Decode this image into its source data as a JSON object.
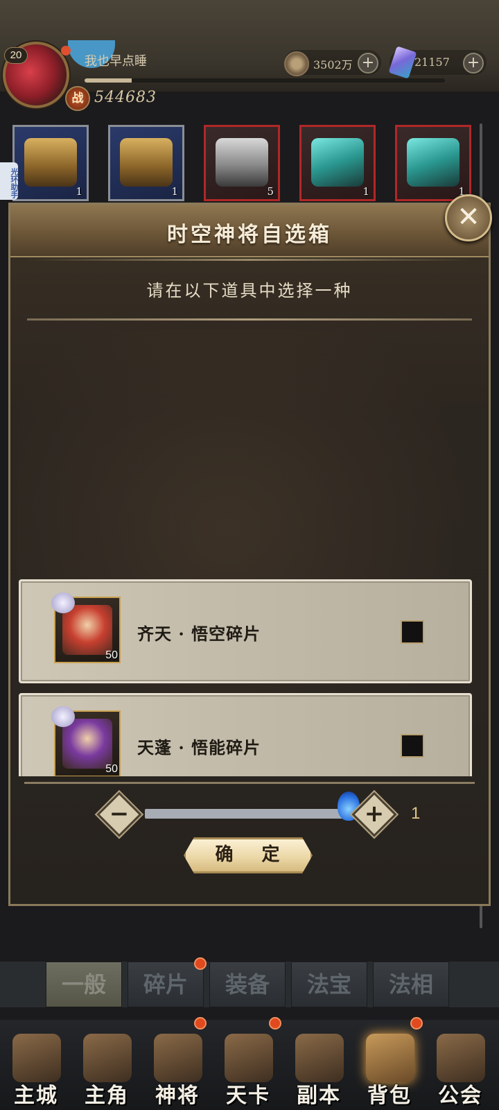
{
  "player": {
    "level": "20",
    "name": "我也早点睡",
    "power_icon": "战",
    "power": "544683",
    "exp_progress": 0.13
  },
  "currencies": [
    {
      "icon": "coin-icon",
      "value": "3502万"
    },
    {
      "icon": "crystal-icon",
      "value": "21157"
    }
  ],
  "items": [
    {
      "art": "gold-chest",
      "count": "1"
    },
    {
      "art": "gold-chest",
      "count": "1"
    },
    {
      "art": "silver-box",
      "count": "5"
    },
    {
      "art": "cyan-cube",
      "count": "1"
    },
    {
      "art": "cyan-cube",
      "count": "1"
    }
  ],
  "side_tab": "光环助手",
  "modal": {
    "title": "时空神将自选箱",
    "prompt": "请在以下道具中选择一种",
    "options": [
      {
        "name": "齐天 · 悟空碎片",
        "count": "50",
        "checked": false
      },
      {
        "name": "天蓬 · 悟能碎片",
        "count": "50",
        "checked": false
      }
    ],
    "minus": "−",
    "plus": "+",
    "quantity": "1",
    "quantity_slider": 1.0,
    "confirm": "确 定",
    "close": "✕"
  },
  "category_tabs": [
    {
      "label": "一般",
      "active": true
    },
    {
      "label": "碎片",
      "active": false
    },
    {
      "label": "装备",
      "active": false
    },
    {
      "label": "法宝",
      "active": false
    },
    {
      "label": "法相",
      "active": false
    }
  ],
  "nav": [
    {
      "label": "主城"
    },
    {
      "label": "主角"
    },
    {
      "label": "神将"
    },
    {
      "label": "天卡"
    },
    {
      "label": "副本"
    },
    {
      "label": "背包"
    },
    {
      "label": "公会"
    }
  ]
}
